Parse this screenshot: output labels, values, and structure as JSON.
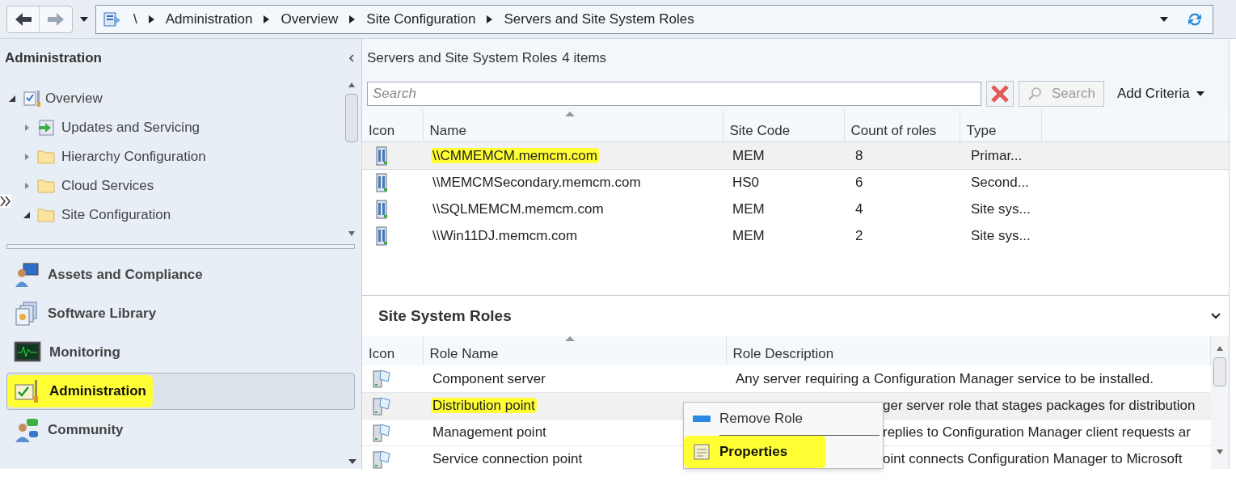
{
  "breadcrumbs": [
    "\\",
    "Administration",
    "Overview",
    "Site Configuration",
    "Servers and Site System Roles"
  ],
  "sidebar": {
    "title": "Administration",
    "tree": [
      {
        "label": "Overview",
        "kind": "overview",
        "expanded": true,
        "children": [
          {
            "label": "Updates and Servicing",
            "kind": "updates",
            "expanded": false
          },
          {
            "label": "Hierarchy Configuration",
            "kind": "folder",
            "expanded": false
          },
          {
            "label": "Cloud Services",
            "kind": "folder",
            "expanded": false
          },
          {
            "label": "Site Configuration",
            "kind": "folder",
            "expanded": true
          }
        ]
      }
    ],
    "workspaces": [
      {
        "label": "Assets and Compliance",
        "kind": "assets",
        "selected": false,
        "highlighted": false
      },
      {
        "label": "Software Library",
        "kind": "library",
        "selected": false,
        "highlighted": false
      },
      {
        "label": "Monitoring",
        "kind": "monitoring",
        "selected": false,
        "highlighted": false
      },
      {
        "label": "Administration",
        "kind": "administration",
        "selected": true,
        "highlighted": true
      },
      {
        "label": "Community",
        "kind": "community",
        "selected": false,
        "highlighted": false
      }
    ]
  },
  "servers": {
    "title": "Servers and Site System Roles",
    "count": "4 items",
    "search": {
      "placeholder": "Search"
    },
    "search_button": "Search",
    "add_criteria": "Add Criteria",
    "columns": [
      "Icon",
      "Name",
      "Site Code",
      "Count of roles",
      "Type"
    ],
    "rows": [
      {
        "name": "\\\\CMMEMCM.memcm.com",
        "site_code": "MEM",
        "count": "8",
        "type": "Primar...",
        "selected": true,
        "highlighted": true
      },
      {
        "name": "\\\\MEMCMSecondary.memcm.com",
        "site_code": "HS0",
        "count": "6",
        "type": "Second...",
        "selected": false,
        "highlighted": false
      },
      {
        "name": "\\\\SQLMEMCM.memcm.com",
        "site_code": "MEM",
        "count": "4",
        "type": "Site sys...",
        "selected": false,
        "highlighted": false
      },
      {
        "name": "\\\\Win11DJ.memcm.com",
        "site_code": "MEM",
        "count": "2",
        "type": "Site sys...",
        "selected": false,
        "highlighted": false
      }
    ]
  },
  "roles": {
    "title": "Site System Roles",
    "columns": [
      "Icon",
      "Role Name",
      "Role Description"
    ],
    "rows": [
      {
        "name": "Component server",
        "description": "Any server requiring a Configuration Manager service to be installed.",
        "covered": false,
        "selected": false,
        "highlighted": false
      },
      {
        "name": "Distribution point",
        "description": "ger server role that stages packages for distribution",
        "covered": true,
        "selected": true,
        "highlighted": true
      },
      {
        "name": "Management point",
        "description": "replies to Configuration Manager client requests ar",
        "covered": true,
        "selected": false,
        "highlighted": false
      },
      {
        "name": "Service connection point",
        "description": "oint connects Configuration Manager to Microsoft",
        "covered": true,
        "selected": false,
        "highlighted": false
      }
    ]
  },
  "context_menu": {
    "items": [
      {
        "label": "Remove Role",
        "kind": "remove",
        "default": false,
        "highlighted": false
      },
      {
        "label": "Properties",
        "kind": "properties",
        "default": true,
        "highlighted": true
      }
    ]
  }
}
